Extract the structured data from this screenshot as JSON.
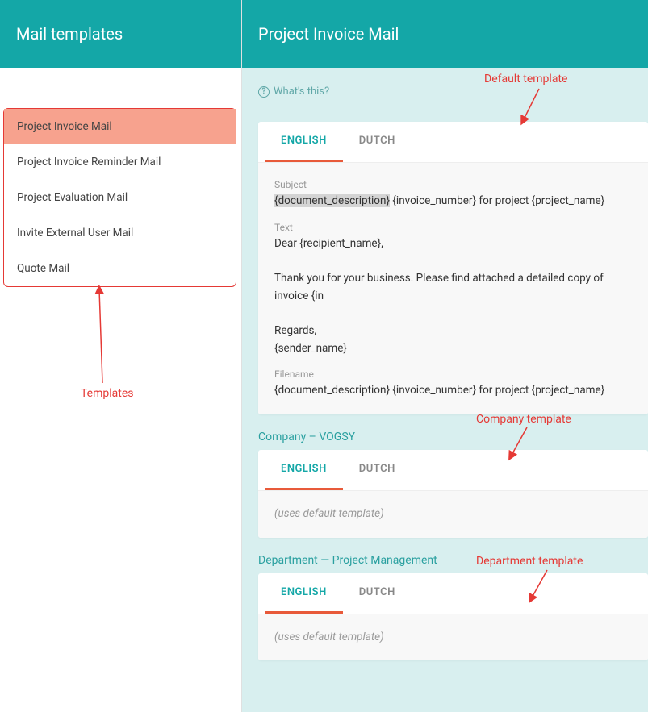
{
  "sidebar": {
    "title": "Mail templates",
    "items": [
      {
        "label": "Project Invoice Mail",
        "active": true
      },
      {
        "label": "Project Invoice Reminder Mail"
      },
      {
        "label": "Project Evaluation Mail"
      },
      {
        "label": "Invite External User Mail"
      },
      {
        "label": "Quote Mail"
      }
    ]
  },
  "main": {
    "title": "Project Invoice Mail",
    "whats_this": "What's this?",
    "default_section": {
      "tabs": [
        "ENGLISH",
        "DUTCH"
      ],
      "subject_label": "Subject",
      "subject_highlight": "{document_description}",
      "subject_rest": " {invoice_number} for project {project_name}",
      "text_label": "Text",
      "text_body": "Dear {recipient_name},\n\nThank you for your business. Please find attached a detailed copy of invoice {in\n\nRegards,\n{sender_name}",
      "filename_label": "Filename",
      "filename_value": "{document_description} {invoice_number} for project {project_name}"
    },
    "company_section": {
      "heading": "Company – VOGSY",
      "tabs": [
        "ENGLISH",
        "DUTCH"
      ],
      "body": "(uses default template)"
    },
    "department_section": {
      "heading": "Department — Project Management",
      "tabs": [
        "ENGLISH",
        "DUTCH"
      ],
      "body": "(uses default template)"
    }
  },
  "annotations": {
    "templates": "Templates",
    "default_template": "Default template",
    "company_template": "Company template",
    "department_template": "Department template"
  }
}
